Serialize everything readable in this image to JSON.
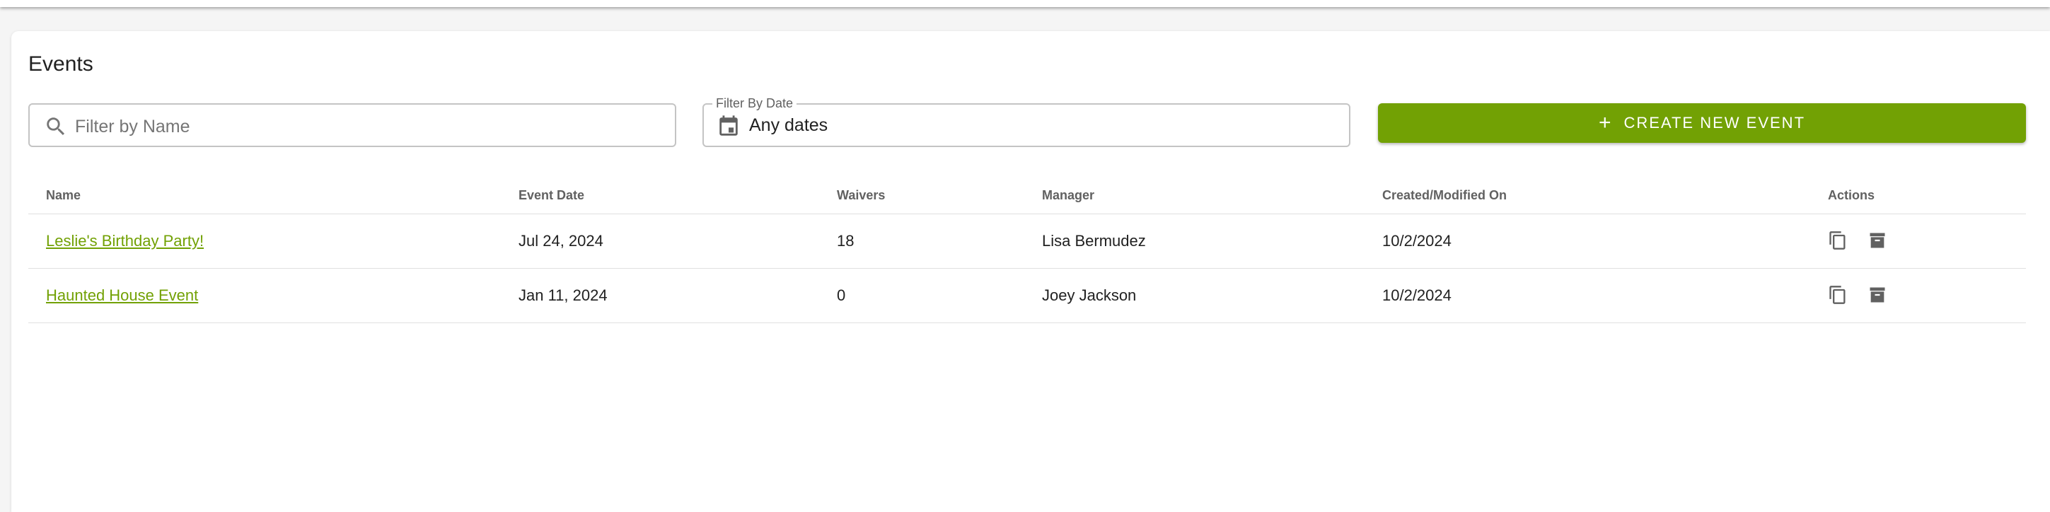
{
  "page": {
    "title": "Events"
  },
  "filters": {
    "name_placeholder": "Filter by Name",
    "name_value": "",
    "date_label": "Filter By Date",
    "date_value": "Any dates"
  },
  "toolbar": {
    "create_label": "CREATE NEW EVENT"
  },
  "table": {
    "columns": {
      "name": "Name",
      "event_date": "Event Date",
      "waivers": "Waivers",
      "manager": "Manager",
      "created": "Created/Modified On",
      "actions": "Actions"
    },
    "rows": [
      {
        "name": "Leslie's Birthday Party!",
        "event_date": "Jul 24, 2024",
        "waivers": "18",
        "manager": "Lisa Bermudez",
        "created": "10/2/2024"
      },
      {
        "name": "Haunted House Event",
        "event_date": "Jan 11, 2024",
        "waivers": "0",
        "manager": "Joey Jackson",
        "created": "10/2/2024"
      }
    ]
  },
  "icons": {
    "search": "search-icon",
    "calendar": "calendar-icon",
    "add": "plus-icon",
    "copy": "copy-icon",
    "archive": "archive-icon"
  },
  "colors": {
    "accent": "#72a104",
    "icon_gray": "#616161"
  }
}
